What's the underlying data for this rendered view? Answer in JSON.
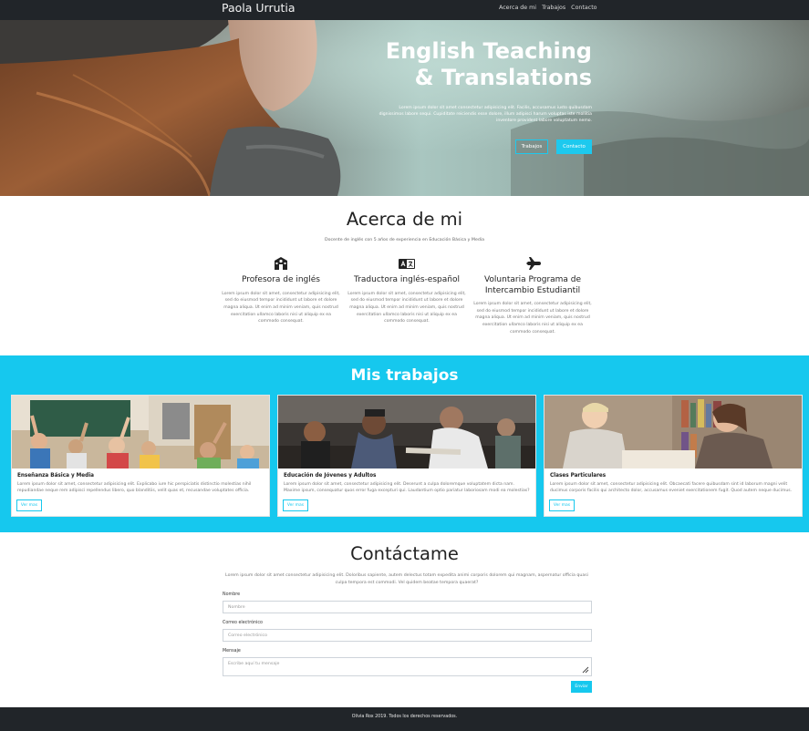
{
  "navbar": {
    "brand": "Paola Urrutia",
    "links": [
      "Acerca de mi",
      "Trabajos",
      "Contacto"
    ]
  },
  "hero": {
    "title_line1": "English Teaching",
    "title_line2": "& Translations",
    "text": "Lorem ipsum dolor sit amet consectetur adipisicing elit. Facilis, accusamus iusto quibusdam dignissimos labore sequi. Cupiditate reiciendis esse dolore, illum adipisci harum voluptas iste mollitia inventore provident labore voluptatum nemo.",
    "button_outline": "Trabajos",
    "button_solid": "Contacto"
  },
  "about": {
    "title": "Acerca de mi",
    "subtitle": "Docente de inglés con 5 años de experiencia en Educación Básica y Media",
    "columns": [
      {
        "icon": "school-icon",
        "title": "Profesora de inglés",
        "text": "Lorem ipsum dolor sit amet, consectetur adipisicing elit, sed do eiusmod tempor incididunt ut labore et dolore magna aliqua. Ut enim ad minim veniam, quis nostrud exercitation ullamco laboris nisi ut aliquip ex ea commodo consequat."
      },
      {
        "icon": "translate-icon",
        "title": "Traductora inglés-español",
        "text": "Lorem ipsum dolor sit amet, consectetur adipisicing elit, sed do eiusmod tempor incididunt ut labore et dolore magna aliqua. Ut enim ad minim veniam, quis nostrud exercitation ullamco laboris nisi ut aliquip ex ea commodo consequat."
      },
      {
        "icon": "airplane-icon",
        "title": "Voluntaria Programa de Intercambio Estudiantil",
        "text": "Lorem ipsum dolor sit amet, consectetur adipisicing elit, sed do eiusmod tempor incididunt ut labore et dolore magna aliqua. Ut enim ad minim veniam, quis nostrud exercitation ullamco laboris nisi ut aliquip ex ea commodo consequat."
      }
    ]
  },
  "works": {
    "title": "Mis trabajos",
    "cards": [
      {
        "title": "Enseñanza Básica y Media",
        "text": "Lorem ipsum dolor sit amet, consectetur adipisicing elit. Explicabo iure hic perspiciatis distinctio molestias nihil repudiandae neque rem adipisci repellendus libero, quo blanditiis, velit quas et, recusandae voluptates officia.",
        "button": "Ver mas"
      },
      {
        "title": "Educación de Jóvenes y Adultos",
        "text": "Lorem ipsum dolor sit amet, consectetur adipisicing elit. Deserunt a culpa doloremque voluptatem dicta nam. Maxime ipsum, consequatur quos error fuga excepturi qui. Laudantium optio pariatur laboriosam modi ea molestias?",
        "button": "Ver mas"
      },
      {
        "title": "Clases Particulares",
        "text": "Lorem ipsum dolor sit amet, consectetur adipisicing elit. Obcaecati facere quibusdam sint id laborum magni velit ducimus corporis facilis qui architecto dolor, accusamus eveniet exercitationem fugit. Quod autem neque ducimus.",
        "button": "Ver mas"
      }
    ]
  },
  "contact": {
    "title": "Contáctame",
    "text": "Lorem ipsum dolor sit amet consectetur adipisicing elit. Doloribus sapiente, autem delectus totam expedita animi corporis dolorem qui magnam, aspernatur officia quasi culpa tempora est commodi. Vel quidem beatae tempora quaerat?",
    "name_label": "Nombre",
    "name_placeholder": "Nombre",
    "email_label": "Correo electrónico",
    "email_placeholder": "Correo electrónico",
    "message_label": "Mensaje",
    "message_placeholder": "Escribe aquí tu mensaje",
    "send_button": "Enviar"
  },
  "footer": {
    "text": "Olivia Rox 2019. Todos los derechos reservados."
  },
  "colors": {
    "accent": "#16c8ee",
    "dark": "#212529"
  }
}
